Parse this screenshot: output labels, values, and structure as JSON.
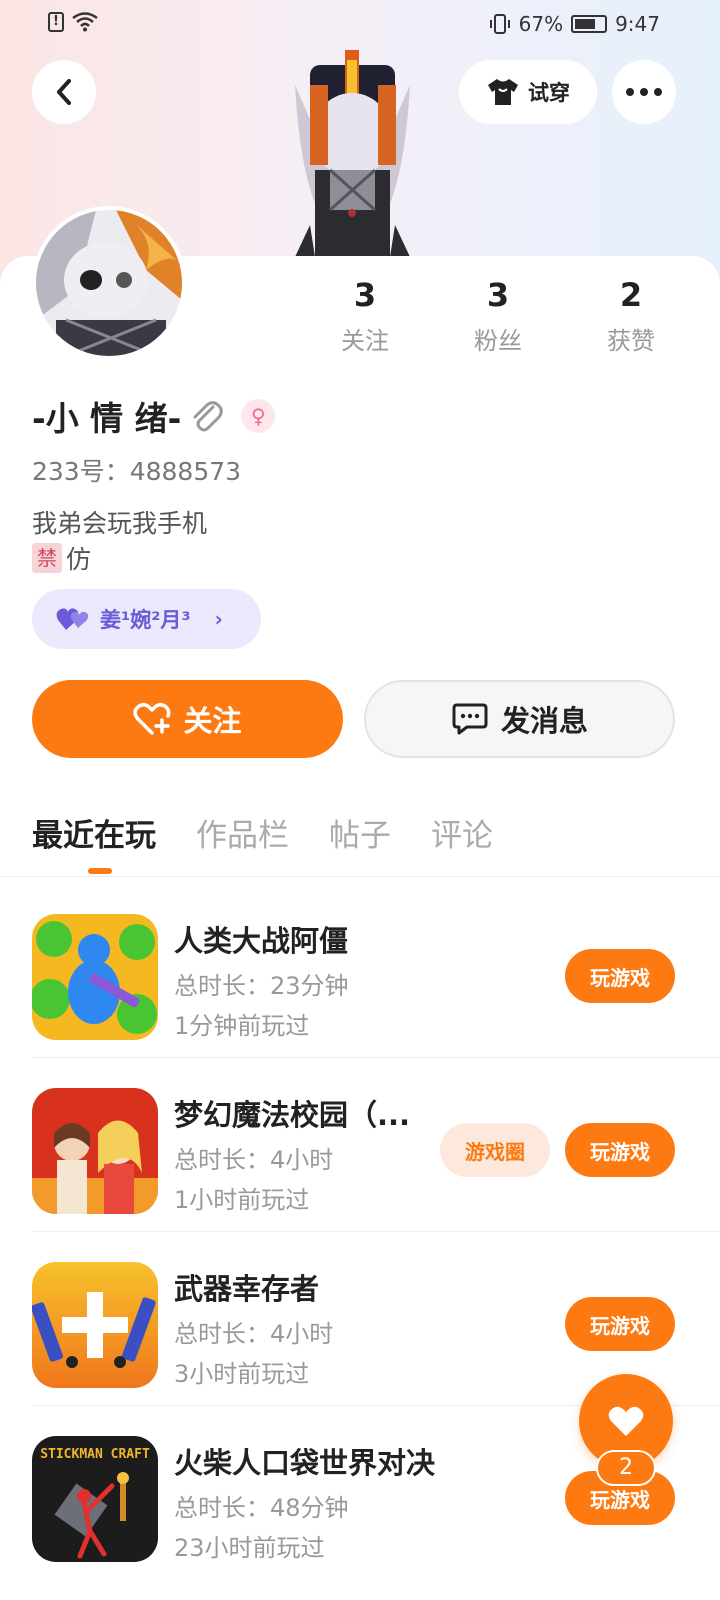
{
  "status_bar": {
    "battery": "67%",
    "time": "9:47"
  },
  "header": {
    "tryon_label": "试穿"
  },
  "profile": {
    "stats": [
      {
        "value": "3",
        "label": "关注"
      },
      {
        "value": "3",
        "label": "粉丝"
      },
      {
        "value": "2",
        "label": "获赞"
      }
    ],
    "name": "-小 情 绪-",
    "uid": "233号：4888573",
    "bio_line1": "我弟会玩我手机",
    "bio_tag": "禁",
    "bio_line2_text": "仿",
    "cp_name": "姜¹婉²月³"
  },
  "actions": {
    "follow": "关注",
    "message": "发消息"
  },
  "tabs": [
    "最近在玩",
    "作品栏",
    "帖子",
    "评论"
  ],
  "games": [
    {
      "title": "人类大战阿僵",
      "duration": "总时长：23分钟",
      "last_played": "1分钟前玩过",
      "play_label": "玩游戏"
    },
    {
      "title": "梦幻魔法校园（...",
      "duration": "总时长：4小时",
      "last_played": "1小时前玩过",
      "play_label": "玩游戏",
      "circle_label": "游戏圈"
    },
    {
      "title": "武器幸存者",
      "duration": "总时长：4小时",
      "last_played": "3小时前玩过",
      "play_label": "玩游戏"
    },
    {
      "title": "火柴人口袋世界对决",
      "duration": "总时长：48分钟",
      "last_played": "23小时前玩过",
      "play_label": "玩游戏",
      "icon_text": "STICKMAN CRAFT"
    }
  ],
  "like_fab": {
    "count": "2"
  },
  "colors": {
    "accent": "#fd7a13",
    "cp_purple": "#6a5bd8"
  }
}
